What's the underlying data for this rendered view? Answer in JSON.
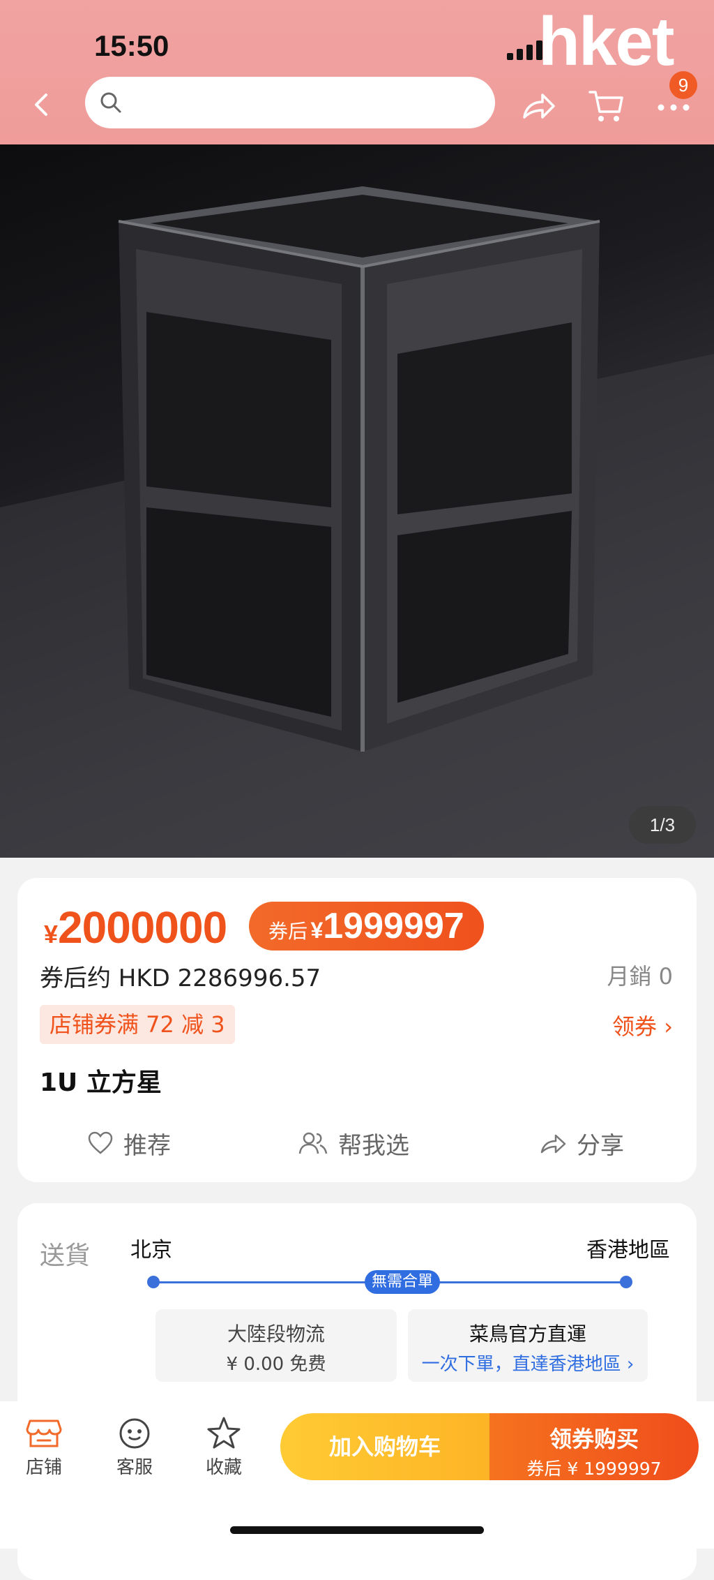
{
  "status": {
    "time": "15:50",
    "watermark": "hket"
  },
  "header": {
    "search_placeholder": "",
    "cart_badge": "9"
  },
  "product_image": {
    "counter": "1/3"
  },
  "price": {
    "currency": "¥",
    "original": "2000000",
    "coupon_label": "券后",
    "coupon_currency": "¥",
    "coupon_value": "1999997",
    "hkd_text": "券后约 HKD 2286996.57",
    "monthly_sales": "月銷 0",
    "shop_coupon": "店铺券满 72 减 3",
    "get_coupon": "领券 ›",
    "title": "1U 立方星"
  },
  "actions": {
    "recommend": "推荐",
    "help_choose": "帮我选",
    "share": "分享"
  },
  "delivery": {
    "label": "送貨",
    "from": "北京",
    "to": "香港地區",
    "tag": "無需合單",
    "segment1_title": "大陸段物流",
    "segment1_sub": "¥ 0.00 免费",
    "segment2_title": "菜鳥官方直運",
    "segment2_sub": "一次下單，直達香港地區 ›"
  },
  "bottom_bar": {
    "shop": "店铺",
    "service": "客服",
    "favorite": "收藏",
    "add_to_cart": "加入购物车",
    "buy_title": "领券购买",
    "buy_sub": "券后 ¥ 1999997"
  },
  "colors": {
    "header_pink": "#ef9c9a",
    "accent_orange": "#f0521b",
    "cart_yellow": "#fdb426",
    "route_blue": "#2f6de0"
  }
}
